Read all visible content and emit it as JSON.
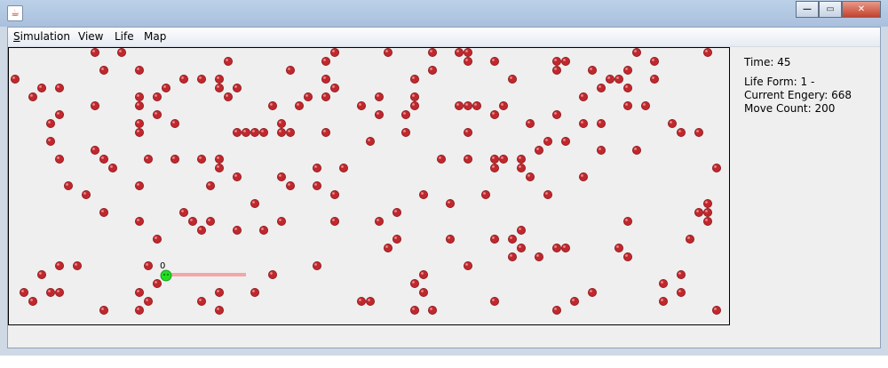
{
  "window": {
    "title": "",
    "buttons": [
      "minimize",
      "maximize",
      "close"
    ]
  },
  "menu": [
    {
      "label": "Simulation",
      "mnemonic": "S"
    },
    {
      "label": "View"
    },
    {
      "label": "Life"
    },
    {
      "label": "Map"
    }
  ],
  "stats": {
    "time": "Time: 45",
    "life_form": "Life Form: 1 -",
    "current_energy": "Current Engery: 668",
    "move_count": "Move Count: 200"
  },
  "agent": {
    "label": "0",
    "color": "#22dd22",
    "trail_color": "#f4a6a6"
  },
  "food_color": "#c0282d"
}
